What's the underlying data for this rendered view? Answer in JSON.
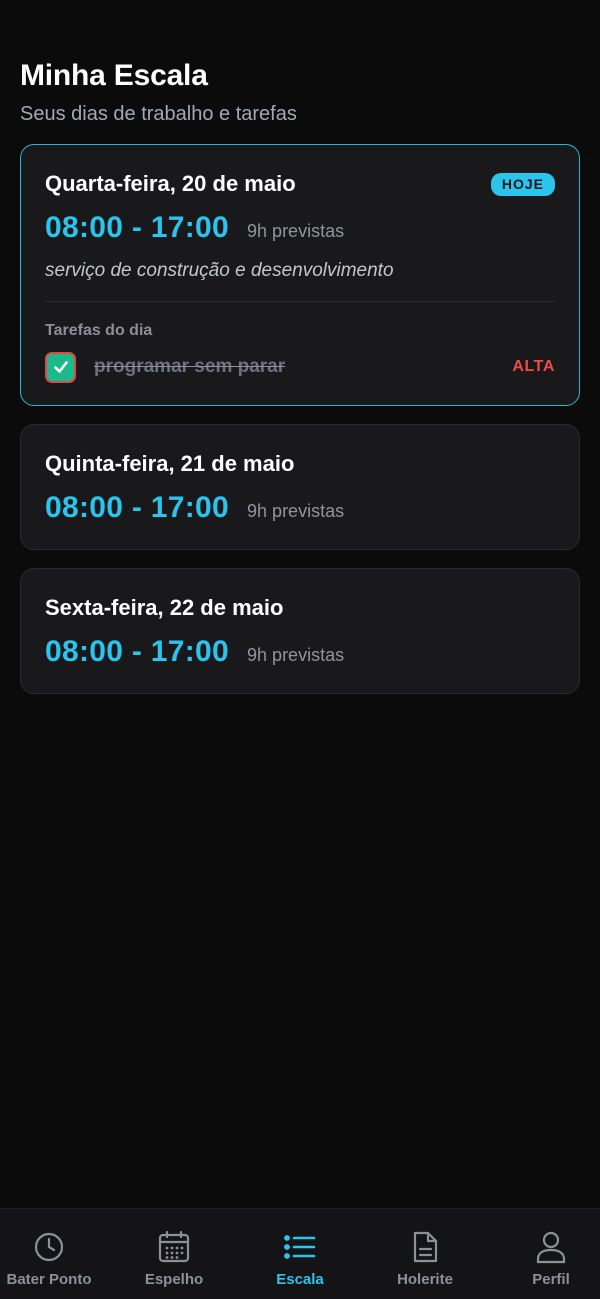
{
  "header": {
    "title": "Minha Escala",
    "subtitle": "Seus dias de trabalho e tarefas"
  },
  "days": [
    {
      "date": "Quarta-feira, 20 de maio",
      "badge": "HOJE",
      "time": "08:00 - 17:00",
      "hours": "9h previstas",
      "description": "serviço de construção e desenvolvimento",
      "tasks_heading": "Tarefas do dia",
      "tasks": [
        {
          "label": "programar sem parar",
          "priority": "ALTA",
          "done": true
        }
      ]
    },
    {
      "date": "Quinta-feira, 21 de maio",
      "time": "08:00 - 17:00",
      "hours": "9h previstas"
    },
    {
      "date": "Sexta-feira, 22 de maio",
      "time": "08:00 - 17:00",
      "hours": "9h previstas"
    }
  ],
  "tabbar": {
    "items": [
      {
        "label": "Bater Ponto",
        "icon": "clock-icon",
        "active": false
      },
      {
        "label": "Espelho",
        "icon": "calendar-icon",
        "active": false
      },
      {
        "label": "Escala",
        "icon": "list-icon",
        "active": true
      },
      {
        "label": "Holerite",
        "icon": "document-icon",
        "active": false
      },
      {
        "label": "Perfil",
        "icon": "user-icon",
        "active": false
      }
    ]
  },
  "colors": {
    "background": "#0b0b0c",
    "card": "#19191b",
    "accent": "#2bc4ec",
    "priority_high": "#ef4a4a",
    "check_fill": "#1cb98a",
    "muted_text": "#8b919c"
  }
}
